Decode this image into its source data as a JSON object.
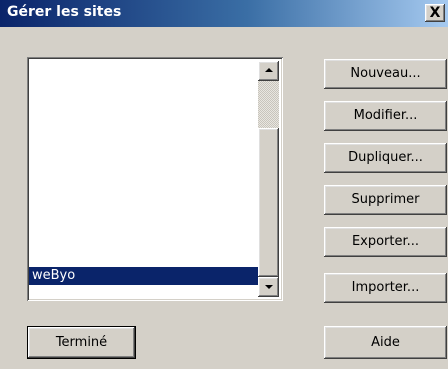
{
  "window": {
    "title": "Gérer les sites",
    "close_label": "X"
  },
  "sites_list": {
    "items": [
      "weByo"
    ],
    "selected": "weByo"
  },
  "buttons": {
    "new": "Nouveau...",
    "modify": "Modifier...",
    "duplicate": "Dupliquer...",
    "delete": "Supprimer",
    "export": "Exporter...",
    "import": "Importer...",
    "done": "Terminé",
    "help": "Aide"
  },
  "icons": {
    "scroll_up": "arrow-up-icon",
    "scroll_down": "arrow-down-icon"
  },
  "colors": {
    "title_bar_start": "#0a246a",
    "title_bar_end": "#a6caf0",
    "selection": "#0a246a",
    "dialog_bg": "#d4d0c8"
  }
}
